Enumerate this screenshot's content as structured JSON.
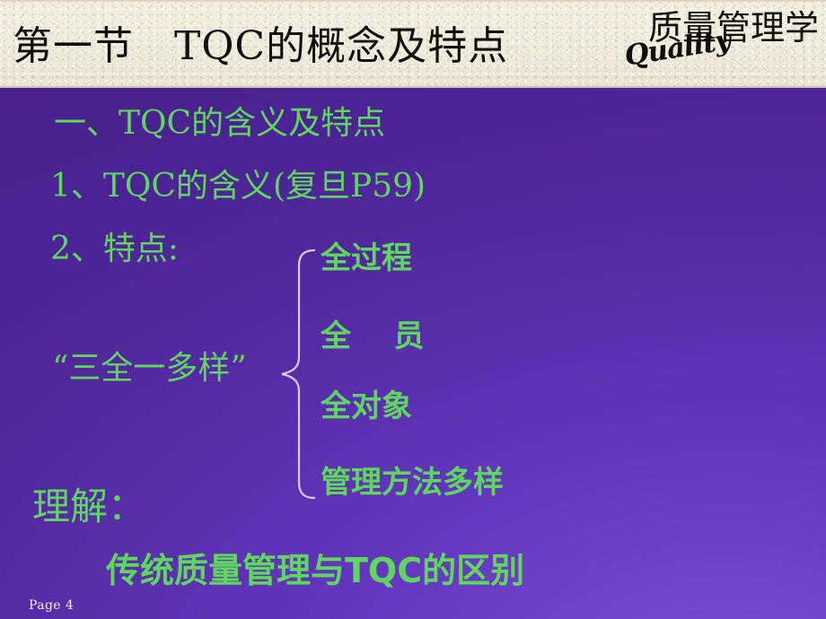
{
  "slide": {
    "page_label": "Page 4",
    "accent_green": "#5fd75f",
    "background_purple": "#5b2fa8",
    "band_cream": "#edead9",
    "brace_color": "#e4c7ef"
  },
  "header": {
    "title": "第一节　TQC的概念及特点",
    "logo_cn": "质量管理学",
    "logo_en": "Quality"
  },
  "body": {
    "heading": "一、TQC的含义及特点",
    "meaning": "1、TQC的含义(复旦P59)",
    "features_label": "2、特点:",
    "grouped_label": "“三全一多样”",
    "features": [
      "全过程",
      "全    员",
      "全对象",
      "管理方法多样"
    ],
    "understand_label": "理解：",
    "conclusion": "传统质量管理与TQC的区别"
  }
}
